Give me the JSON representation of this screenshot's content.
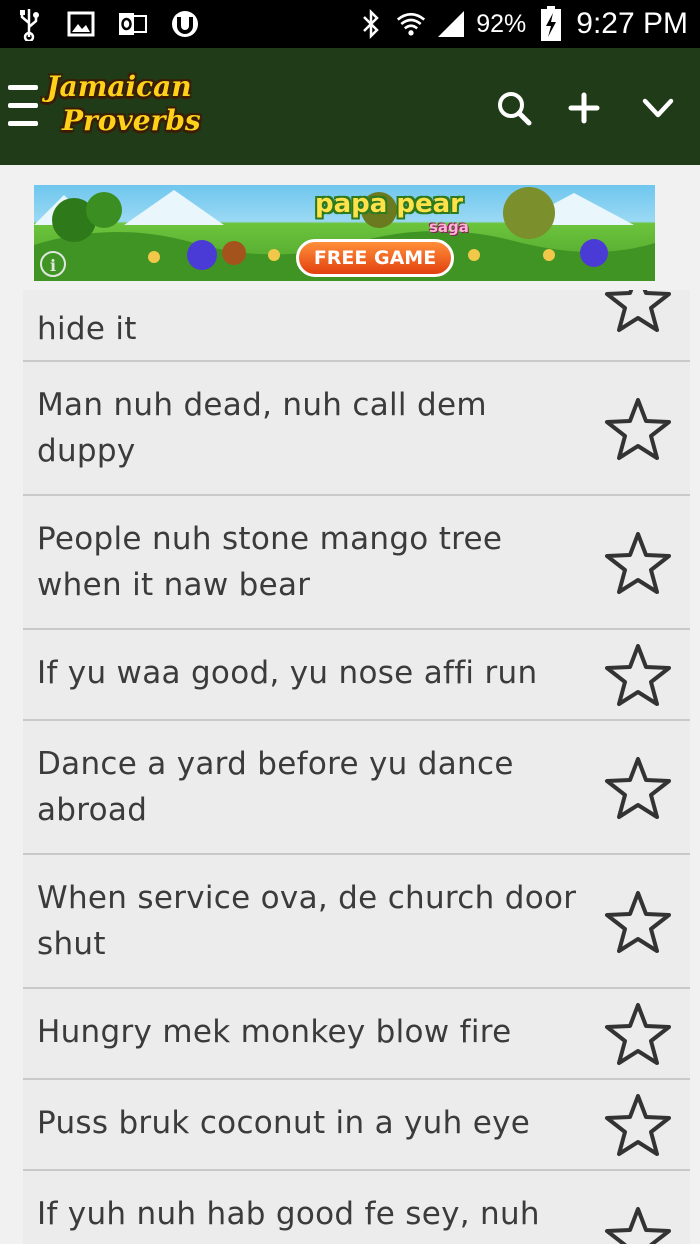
{
  "status_bar": {
    "battery_percent": "92%",
    "time": "9:27 PM",
    "left_icons": [
      "usb-icon",
      "image-icon",
      "outlook-icon",
      "utorrent-icon"
    ],
    "right_icons": [
      "bluetooth-icon",
      "wifi-icon",
      "signal-icon",
      "battery-charging-icon"
    ]
  },
  "app_bar": {
    "logo_line1": "Jamaican",
    "logo_line2": "Proverbs",
    "actions": [
      "search-icon",
      "add-icon",
      "chevron-down-icon"
    ],
    "background": "#1f3b17",
    "logo_color": "#ffd21a"
  },
  "ad": {
    "title": "papa pear",
    "subtitle": "saga",
    "button_label": "FREE GAME",
    "info_glyph": "i"
  },
  "proverbs": [
    {
      "text": "hide it",
      "favorite": false
    },
    {
      "text": "Man nuh dead, nuh call dem duppy",
      "favorite": false
    },
    {
      "text": "People nuh stone mango tree when it naw bear",
      "favorite": false
    },
    {
      "text": "If yu waa good, yu nose affi run",
      "favorite": false
    },
    {
      "text": "Dance a yard before yu dance abroad",
      "favorite": false
    },
    {
      "text": "When service ova, de church door shut",
      "favorite": false
    },
    {
      "text": "Hungry mek monkey blow fire",
      "favorite": false
    },
    {
      "text": "Puss bruk coconut in a yuh eye",
      "favorite": false
    },
    {
      "text": "If yuh nuh hab good fe sey, nuh",
      "favorite": false
    }
  ]
}
